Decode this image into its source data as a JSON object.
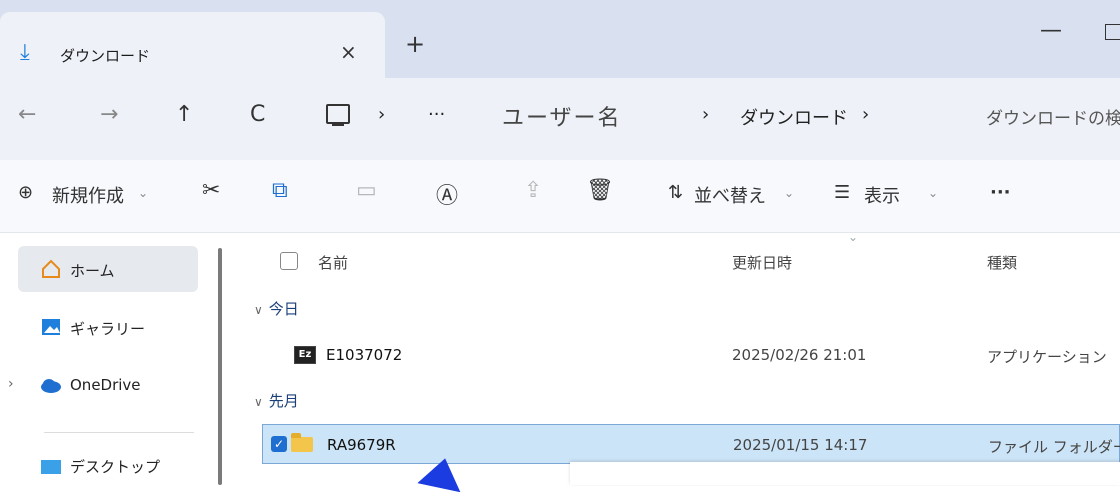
{
  "tab": {
    "title": "ダウンロード",
    "close": "×",
    "new": "+"
  },
  "window": {
    "minimize": "—"
  },
  "nav": {
    "back": "←",
    "forward": "→",
    "up": "↑",
    "refresh": "C",
    "sep": "›",
    "more": "···",
    "crumbs": [
      "ユーザー名",
      "ダウンロード"
    ],
    "search_placeholder": "ダウンロードの検"
  },
  "toolbar": {
    "new": "新規作成",
    "sort": "並べ替え",
    "view": "表示",
    "more": "···",
    "caret": "⌄"
  },
  "sidebar": {
    "items": [
      {
        "label": "ホーム"
      },
      {
        "label": "ギャラリー"
      },
      {
        "label": "OneDrive"
      },
      {
        "label": "デスクトップ"
      }
    ]
  },
  "columns": {
    "name": "名前",
    "modified": "更新日時",
    "type": "種類"
  },
  "groups": [
    {
      "label": "今日"
    },
    {
      "label": "先月"
    }
  ],
  "files": [
    {
      "name": "E1037072",
      "modified": "2025/02/26 21:01",
      "type": "アプリケーション",
      "icon_text": "Ez"
    },
    {
      "name": "RA9679R",
      "modified": "2025/01/15 14:17",
      "type": "ファイル フォルダー"
    }
  ],
  "colors": {
    "accent": "#1f6fd1",
    "selection": "#cce4f7",
    "folder": "#f3c54b"
  }
}
